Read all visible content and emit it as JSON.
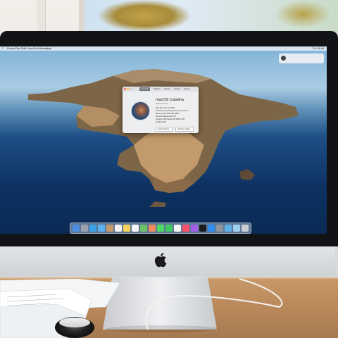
{
  "scene": {
    "description_colors": {
      "bezel": "#111316",
      "chin": "#d8dadd",
      "desk": "#b8875a",
      "sky": "#a9cbe3",
      "sea": "#0d3262"
    }
  },
  "menubar": {
    "items": [
      "Finder",
      "File",
      "Edit",
      "View",
      "Go",
      "Window",
      "Help"
    ],
    "right": "Fri 16:44"
  },
  "notification": {
    "title": "",
    "text": ""
  },
  "about_window": {
    "tabs": [
      "Overview",
      "Displays",
      "Storage",
      "Support",
      "Service"
    ],
    "active_tab": 0,
    "title": "macOS Catalina",
    "version": "Version 10.15.7",
    "specs": [
      "iMac (27-inch, Late 2015)",
      "Processor  3.2 GHz Quad-Core Intel Core i5",
      "Memory  8 GB 1867 MHz DDR3",
      "Startup Disk  Macintosh HD",
      "Graphics  AMD Radeon R9 M380 2 GB",
      "Serial Number"
    ],
    "buttons": [
      "System Report...",
      "Software Update..."
    ]
  },
  "dock": {
    "icons": [
      {
        "name": "finder-icon",
        "color": "#4b8fe0"
      },
      {
        "name": "launchpad-icon",
        "color": "#9aa3ad"
      },
      {
        "name": "safari-icon",
        "color": "#3aa0e6"
      },
      {
        "name": "mail-icon",
        "color": "#5ab0f0"
      },
      {
        "name": "contacts-icon",
        "color": "#c49a6c"
      },
      {
        "name": "calendar-icon",
        "color": "#f2f2f2"
      },
      {
        "name": "notes-icon",
        "color": "#f7d25b"
      },
      {
        "name": "reminders-icon",
        "color": "#f5f5f5"
      },
      {
        "name": "maps-icon",
        "color": "#6cc36a"
      },
      {
        "name": "photos-icon",
        "color": "#f08a5d"
      },
      {
        "name": "messages-icon",
        "color": "#4cd964"
      },
      {
        "name": "facetime-icon",
        "color": "#3fc864"
      },
      {
        "name": "news-icon",
        "color": "#f5f5f5"
      },
      {
        "name": "music-icon",
        "color": "#fa4e6a"
      },
      {
        "name": "podcasts-icon",
        "color": "#a35fe6"
      },
      {
        "name": "tv-icon",
        "color": "#1d1d1f"
      },
      {
        "name": "app-store-icon",
        "color": "#2e8cf0"
      },
      {
        "name": "system-preferences-icon",
        "color": "#8d949c"
      },
      {
        "name": "folder-icon",
        "color": "#5fb0e8"
      },
      {
        "name": "downloads-icon",
        "color": "#9fd0f2"
      },
      {
        "name": "trash-icon",
        "color": "#c9ced4"
      }
    ]
  },
  "apple_logo": ""
}
